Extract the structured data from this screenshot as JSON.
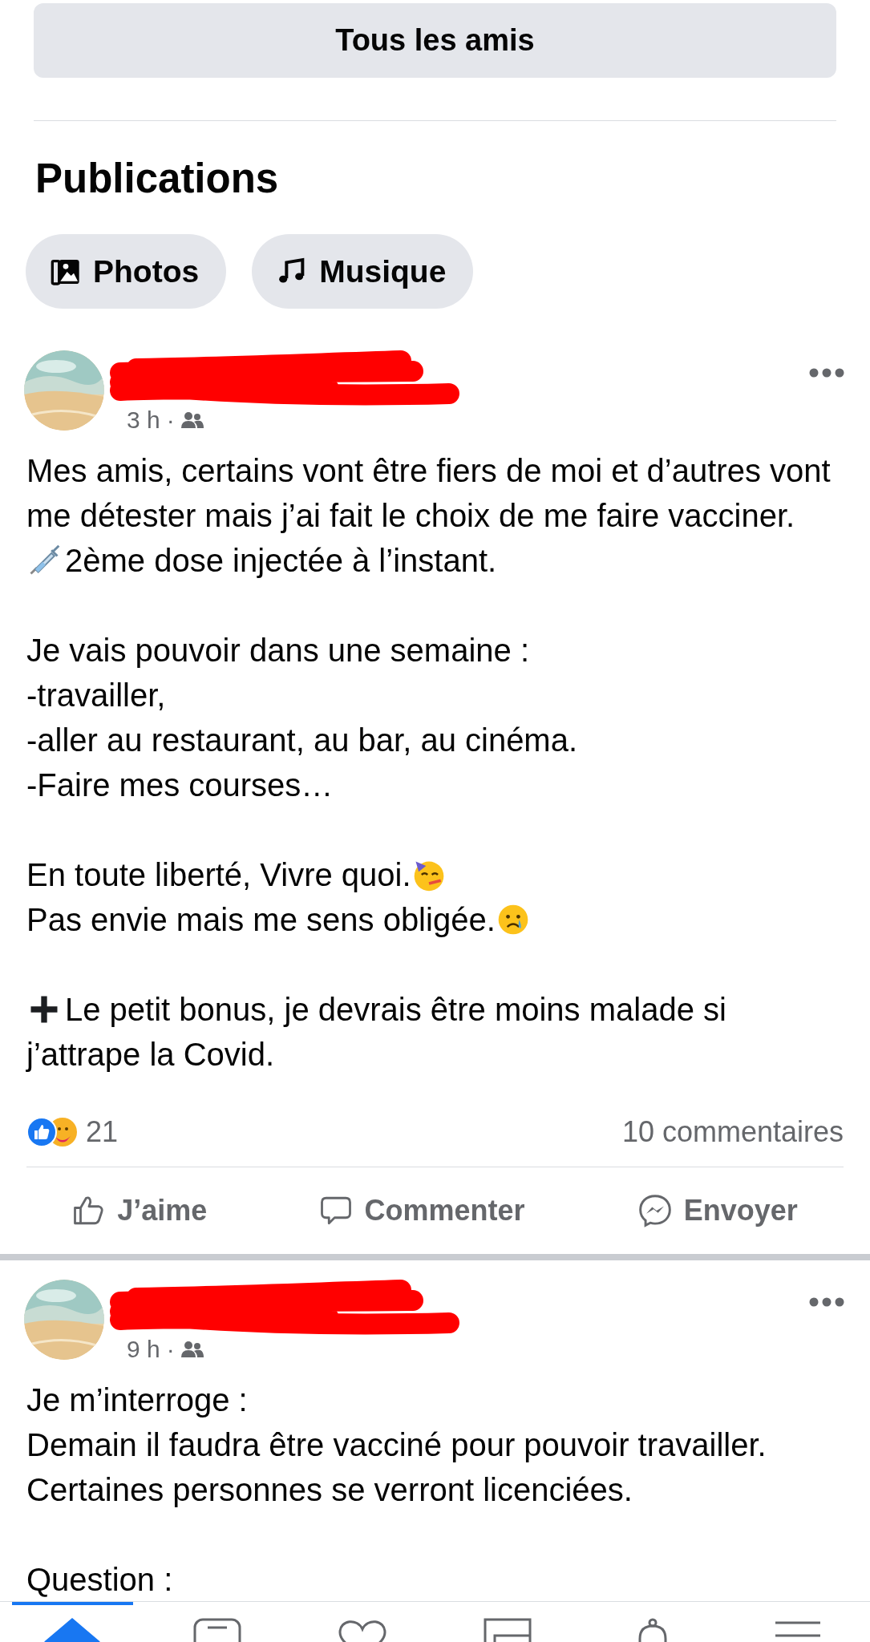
{
  "top_button": {
    "label": "Tous les amis"
  },
  "section_title": "Publications",
  "filters": [
    {
      "label": "Photos",
      "kind": "photos"
    },
    {
      "label": "Musique",
      "kind": "music"
    }
  ],
  "posts": [
    {
      "time": "3 h",
      "separator": "·",
      "paragraphs": [
        [
          {
            "kind": "plain",
            "text": "Mes amis, certains vont être fiers de moi et d’autres vont"
          },
          {
            "kind": "plain",
            "text": "me détester mais j’ai fait le choix de me faire vacciner."
          },
          {
            "kind": "syringe",
            "text": "2ème dose injectée à l’instant."
          }
        ],
        [
          {
            "kind": "plain",
            "text": "Je vais pouvoir dans une semaine :"
          },
          {
            "kind": "plain",
            "text": "-travailler,"
          },
          {
            "kind": "plain",
            "text": "-aller au restaurant, au bar, au cinéma."
          },
          {
            "kind": "plain",
            "text": "-Faire mes courses…"
          }
        ],
        [
          {
            "kind": "party",
            "text": "En toute liberté, Vivre quoi."
          },
          {
            "kind": "crying",
            "text": "Pas envie mais me sens obligée."
          }
        ],
        [
          {
            "kind": "plus",
            "text": "Le petit bonus, je devrais être moins malade si"
          },
          {
            "kind": "plain",
            "text": "j’attrape la Covid."
          }
        ]
      ],
      "reaction_count": "21",
      "comments": "10 commentaires",
      "actions": [
        {
          "kind": "like",
          "label": "J’aime"
        },
        {
          "kind": "comment",
          "label": "Commenter"
        },
        {
          "kind": "send",
          "label": "Envoyer"
        }
      ]
    },
    {
      "time": "9 h",
      "separator": "·",
      "paragraphs": [
        [
          {
            "kind": "plain",
            "text": "Je m’interroge :"
          },
          {
            "kind": "plain",
            "text": "Demain il faudra être vacciné pour pouvoir travailler."
          },
          {
            "kind": "plain",
            "text": "Certaines personnes se verront licenciées."
          }
        ],
        [
          {
            "kind": "plain",
            "text": "Question :"
          }
        ]
      ]
    }
  ],
  "bottom_nav": [
    {
      "kind": "home",
      "selected": true
    },
    {
      "kind": "card",
      "selected": false
    },
    {
      "kind": "heart",
      "selected": false
    },
    {
      "kind": "square",
      "selected": false
    },
    {
      "kind": "bell",
      "selected": false
    },
    {
      "kind": "menu",
      "selected": false
    }
  ]
}
